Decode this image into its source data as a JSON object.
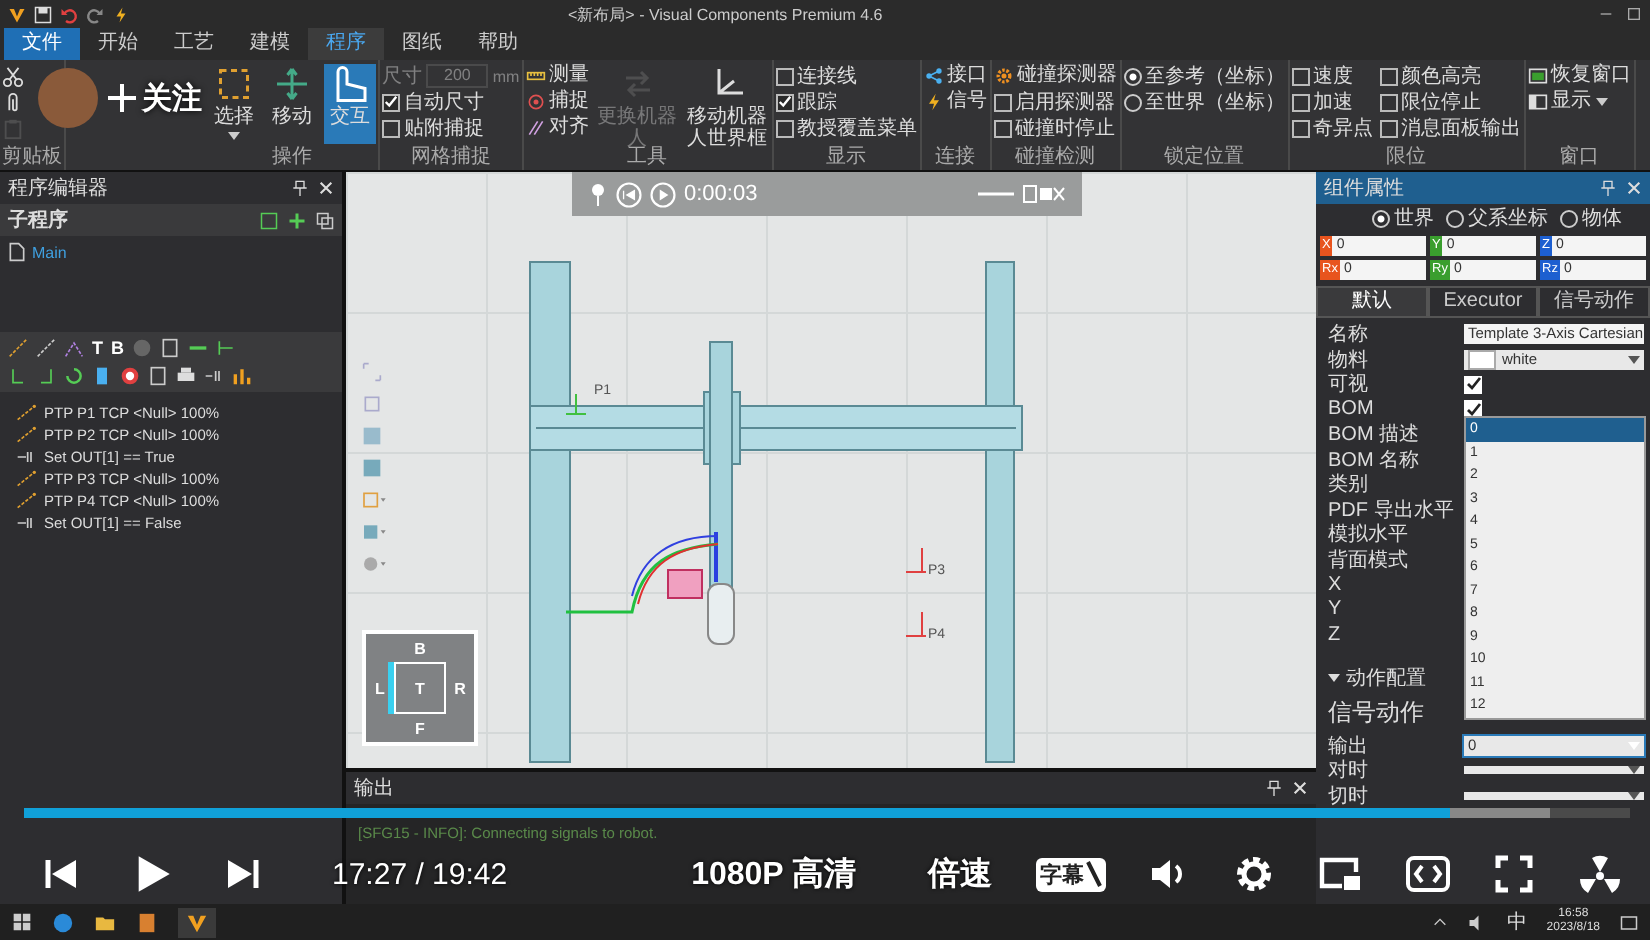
{
  "title_bar": {
    "title": "<新布局> - Visual Components Premium 4.6"
  },
  "menu_tabs": [
    {
      "label": "文件",
      "kind": "file",
      "selected": false
    },
    {
      "label": "开始",
      "kind": "tab",
      "selected": false
    },
    {
      "label": "工艺",
      "kind": "tab",
      "selected": false
    },
    {
      "label": "建模",
      "kind": "tab",
      "selected": false
    },
    {
      "label": "程序",
      "kind": "tab",
      "selected": true
    },
    {
      "label": "图纸",
      "kind": "tab",
      "selected": false
    },
    {
      "label": "帮助",
      "kind": "tab",
      "selected": false
    }
  ],
  "follow_button": {
    "label": "关注"
  },
  "ribbon_groups": [
    {
      "label": "剪贴板",
      "columns": [
        [
          {
            "kind": "icon",
            "disabled": false
          },
          {
            "kind": "icon",
            "disabled": false
          },
          {
            "kind": "icon",
            "disabled": true
          }
        ]
      ]
    },
    {
      "label": "操作",
      "columns": [
        [
          {
            "kind": "big",
            "label": "选择",
            "selected": false,
            "has_menu": true
          }
        ],
        [
          {
            "kind": "big",
            "label": "移动",
            "selected": false
          }
        ],
        [
          {
            "kind": "big",
            "label": "交互",
            "selected": true
          }
        ]
      ]
    },
    {
      "label": "网格捕捉",
      "columns": [
        [
          {
            "kind": "field",
            "label": "尺寸",
            "value": "200",
            "unit": "mm",
            "disabled": true
          },
          {
            "kind": "check",
            "label": "自动尺寸",
            "checked": true
          },
          {
            "kind": "check",
            "label": "贴附捕捉",
            "checked": false
          }
        ]
      ]
    },
    {
      "label": "工具",
      "columns": [
        [
          {
            "kind": "button",
            "label": "测量"
          },
          {
            "kind": "button",
            "label": "捕捉"
          },
          {
            "kind": "button",
            "label": "对齐"
          }
        ],
        [
          {
            "kind": "big",
            "label": "更换机器人",
            "selected": false,
            "disabled": true
          }
        ],
        [
          {
            "kind": "big",
            "label": "移动机器人世界框",
            "selected": false,
            "disabled": false
          }
        ]
      ]
    },
    {
      "label": "显示",
      "columns": [
        [
          {
            "kind": "check",
            "label": "连接线",
            "checked": false
          },
          {
            "kind": "check",
            "label": "跟踪",
            "checked": true
          },
          {
            "kind": "check",
            "label": "教授覆盖菜单",
            "checked": false
          }
        ]
      ]
    },
    {
      "label": "连接",
      "columns": [
        [
          {
            "kind": "button",
            "label": "接口"
          },
          {
            "kind": "button",
            "label": "信号"
          }
        ]
      ]
    },
    {
      "label": "碰撞检测",
      "columns": [
        [
          {
            "kind": "button",
            "label": "碰撞探测器"
          },
          {
            "kind": "check",
            "label": "启用探测器",
            "checked": false
          },
          {
            "kind": "check",
            "label": "碰撞时停止",
            "checked": false
          }
        ]
      ]
    },
    {
      "label": "锁定位置",
      "columns": [
        [
          {
            "kind": "radio",
            "label": "至参考（坐标）",
            "selected": true
          },
          {
            "kind": "radio",
            "label": "至世界（坐标）",
            "selected": false
          }
        ]
      ]
    },
    {
      "label": "限位",
      "columns": [
        [
          {
            "kind": "check",
            "label": "速度",
            "checked": false
          },
          {
            "kind": "check",
            "label": "加速",
            "checked": false
          },
          {
            "kind": "check",
            "label": "奇异点",
            "checked": false
          }
        ],
        [
          {
            "kind": "check",
            "label": "颜色高亮",
            "checked": false
          },
          {
            "kind": "check",
            "label": "限位停止",
            "checked": false
          },
          {
            "kind": "check",
            "label": "消息面板输出",
            "checked": false
          }
        ]
      ]
    },
    {
      "label": "窗口",
      "columns": [
        [
          {
            "kind": "button",
            "label": "恢复窗口"
          },
          {
            "kind": "button",
            "label": "显示",
            "has_menu": true
          }
        ]
      ]
    }
  ],
  "program_editor": {
    "title": "程序编辑器",
    "subprogram_label": "子程序",
    "routines": [
      {
        "label": "Main",
        "selected": true
      }
    ],
    "toolbar_letters": [
      "T",
      "B"
    ],
    "statements": [
      {
        "kind": "ptp",
        "text": "PTP P1 TCP <Null> 100%"
      },
      {
        "kind": "ptp",
        "text": "PTP P2 TCP <Null> 100%"
      },
      {
        "kind": "set",
        "text": "Set OUT[1] == True"
      },
      {
        "kind": "ptp",
        "text": "PTP P3 TCP <Null> 100%"
      },
      {
        "kind": "ptp",
        "text": "PTP P4 TCP <Null> 100%"
      },
      {
        "kind": "set",
        "text": "Set OUT[1] == False"
      }
    ]
  },
  "viewport": {
    "time": "0:00:03",
    "point_labels": [
      "P1",
      "P3",
      "P4"
    ],
    "nav_cube": {
      "faces": [
        {
          "kind": "top",
          "label": "B",
          "selected": false
        },
        {
          "kind": "left",
          "label": "L",
          "selected": true
        },
        {
          "kind": "center",
          "label": "T",
          "selected": false
        },
        {
          "kind": "right",
          "label": "R",
          "selected": false
        },
        {
          "kind": "bottom",
          "label": "F",
          "selected": false
        }
      ]
    }
  },
  "output_panel": {
    "title": "输出",
    "messages": [
      "[SFG15 - INFO]: Connecting signals to robot."
    ]
  },
  "component_properties": {
    "title": "组件属性",
    "frame_options": [
      {
        "label": "世界",
        "selected": true
      },
      {
        "label": "父系坐标",
        "selected": false
      },
      {
        "label": "物体",
        "selected": false
      }
    ],
    "coordinates": [
      {
        "axis": "X",
        "value": "0",
        "color": "#e8541e"
      },
      {
        "axis": "Y",
        "value": "0",
        "color": "#3a9e2e"
      },
      {
        "axis": "Z",
        "value": "0",
        "color": "#1d5fd0"
      },
      {
        "axis": "Rx",
        "value": "0",
        "color": "#e8541e"
      },
      {
        "axis": "Ry",
        "value": "0",
        "color": "#3a9e2e"
      },
      {
        "axis": "Rz",
        "value": "0",
        "color": "#1d5fd0"
      }
    ],
    "tabs": [
      {
        "label": "默认",
        "selected": true
      },
      {
        "label": "Executor",
        "selected": false
      },
      {
        "label": "信号动作",
        "selected": false
      }
    ],
    "properties": [
      {
        "label": "名称",
        "kind": "text",
        "value": "Template 3-Axis Cartesian"
      },
      {
        "label": "物料",
        "kind": "select",
        "value": "white"
      },
      {
        "label": "可视",
        "kind": "check",
        "checked": true
      },
      {
        "label": "BOM",
        "kind": "check",
        "checked": true
      },
      {
        "label": "BOM 描述",
        "kind": "empty"
      },
      {
        "label": "BOM 名称",
        "kind": "empty"
      },
      {
        "label": "类别",
        "kind": "empty"
      },
      {
        "label": "PDF 导出水平",
        "kind": "empty"
      },
      {
        "label": "模拟水平",
        "kind": "empty"
      },
      {
        "label": "背面模式",
        "kind": "empty"
      },
      {
        "label": "X",
        "kind": "empty"
      },
      {
        "label": "Y",
        "kind": "empty"
      },
      {
        "label": "Z",
        "kind": "empty"
      }
    ],
    "dropdown_options": [
      {
        "label": "0",
        "selected": true
      },
      {
        "label": "1",
        "selected": false
      },
      {
        "label": "2",
        "selected": false
      },
      {
        "label": "3",
        "selected": false
      },
      {
        "label": "4",
        "selected": false
      },
      {
        "label": "5",
        "selected": false
      },
      {
        "label": "6",
        "selected": false
      },
      {
        "label": "7",
        "selected": false
      },
      {
        "label": "8",
        "selected": false
      },
      {
        "label": "9",
        "selected": false
      },
      {
        "label": "10",
        "selected": false
      },
      {
        "label": "11",
        "selected": false
      },
      {
        "label": "12",
        "selected": false
      }
    ],
    "action_config": {
      "label": "动作配置",
      "expanded": true,
      "heading": "信号动作",
      "rows": [
        {
          "label": "输出",
          "value": "0",
          "focused": true
        },
        {
          "label": "对时",
          "focused": false
        },
        {
          "label": "切时",
          "focused": false
        }
      ]
    }
  },
  "player": {
    "progress": {
      "level": 0.888
    },
    "buffer": {
      "level": 0.95
    },
    "time": "17:27 / 19:42",
    "quality": "1080P 高清",
    "speed": "倍速",
    "subtitle": {
      "label": "字幕",
      "on": false
    }
  },
  "taskbar": {
    "input_method": "中",
    "clock": "16:58",
    "date": "2023/8/18"
  }
}
